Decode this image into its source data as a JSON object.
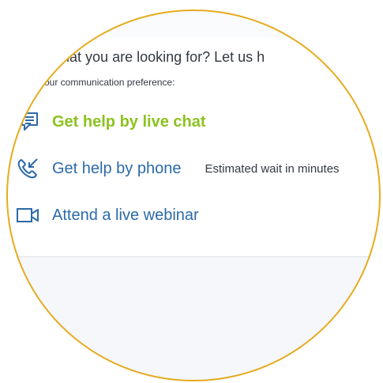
{
  "headline": "nd what you are looking for? Let us h",
  "subline": "e your communication preference:",
  "options": [
    {
      "label": "Get help by live chat",
      "icon": "chat-icon",
      "note": ""
    },
    {
      "label": "Get help by phone",
      "icon": "phone-icon",
      "note": "Estimated wait in minutes"
    },
    {
      "label": "Attend a live webinar",
      "icon": "video-camera-icon",
      "note": ""
    }
  ],
  "colors": {
    "lens_ring": "#e6ab1e",
    "link_blue": "#2c6aa8",
    "active_green": "#8cc21f",
    "text_dark": "#333840"
  }
}
